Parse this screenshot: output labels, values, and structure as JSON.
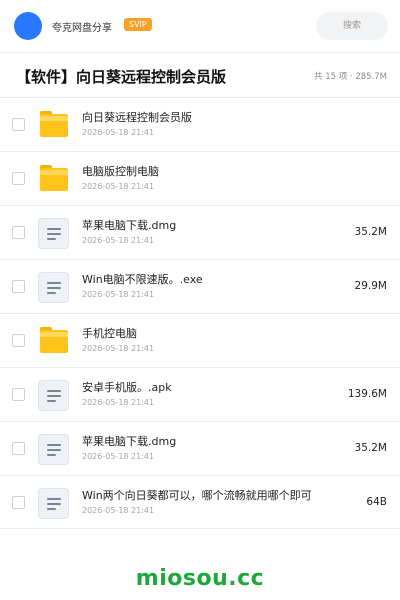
{
  "header": {
    "username": "夸克网盘分享",
    "svip_badge": "SVIP",
    "search_label": "搜索"
  },
  "share": {
    "title": "【软件】向日葵远程控制会员版",
    "meta": "共 15 项 · 285.7M"
  },
  "files": [
    {
      "type": "folder",
      "name": "向日葵远程控制会员版",
      "date": "2026-05-18 21:41",
      "size": ""
    },
    {
      "type": "folder",
      "name": "电脑版控制电脑",
      "date": "2026-05-18 21:41",
      "size": ""
    },
    {
      "type": "file",
      "name": "苹果电脑下载.dmg",
      "date": "2026-05-18 21:41",
      "size": "35.2M"
    },
    {
      "type": "file",
      "name": "Win电脑不限速版。.exe",
      "date": "2026-05-18 21:41",
      "size": "29.9M"
    },
    {
      "type": "folder",
      "name": "手机控电脑",
      "date": "2026-05-18 21:41",
      "size": ""
    },
    {
      "type": "file",
      "name": "安卓手机版。.apk",
      "date": "2026-05-18 21:41",
      "size": "139.6M"
    },
    {
      "type": "file",
      "name": "苹果电脑下载.dmg",
      "date": "2026-05-18 21:41",
      "size": "35.2M"
    },
    {
      "type": "file",
      "name": "Win两个向日葵都可以，哪个流畅就用哪个即可",
      "date": "2026-05-18 21:41",
      "size": "64B"
    }
  ],
  "watermark": "miosou.cc",
  "icons": {
    "folder": "folder-icon",
    "file": "document-icon"
  },
  "colors": {
    "accent": "#2a78ff",
    "svip": "#f5a12a",
    "folder": "#ffc31a",
    "watermark": "#1ea83c"
  }
}
